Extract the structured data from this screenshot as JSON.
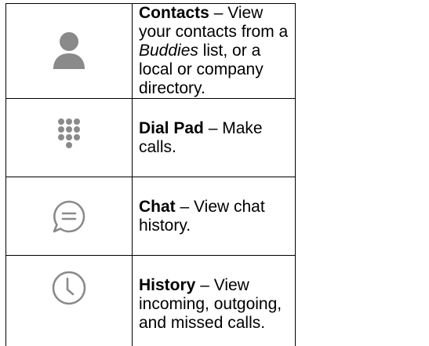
{
  "rows": [
    {
      "icon": "contacts-person-icon",
      "term": "Contacts",
      "dash": " – View your contacts from a ",
      "emphasis": "Buddies",
      "rest": " list, or a local or company directory."
    },
    {
      "icon": "dial-pad-icon",
      "term": "Dial Pad",
      "rest": " – Make calls."
    },
    {
      "icon": "chat-bubble-icon",
      "term": "Chat",
      "rest": " – View chat history."
    },
    {
      "icon": "clock-history-icon",
      "term": "History",
      "rest": " – View incoming, outgoing, and missed calls."
    }
  ],
  "colors": {
    "icon_gray": "#8a8a8a",
    "border": "#000000",
    "text": "#000000"
  }
}
